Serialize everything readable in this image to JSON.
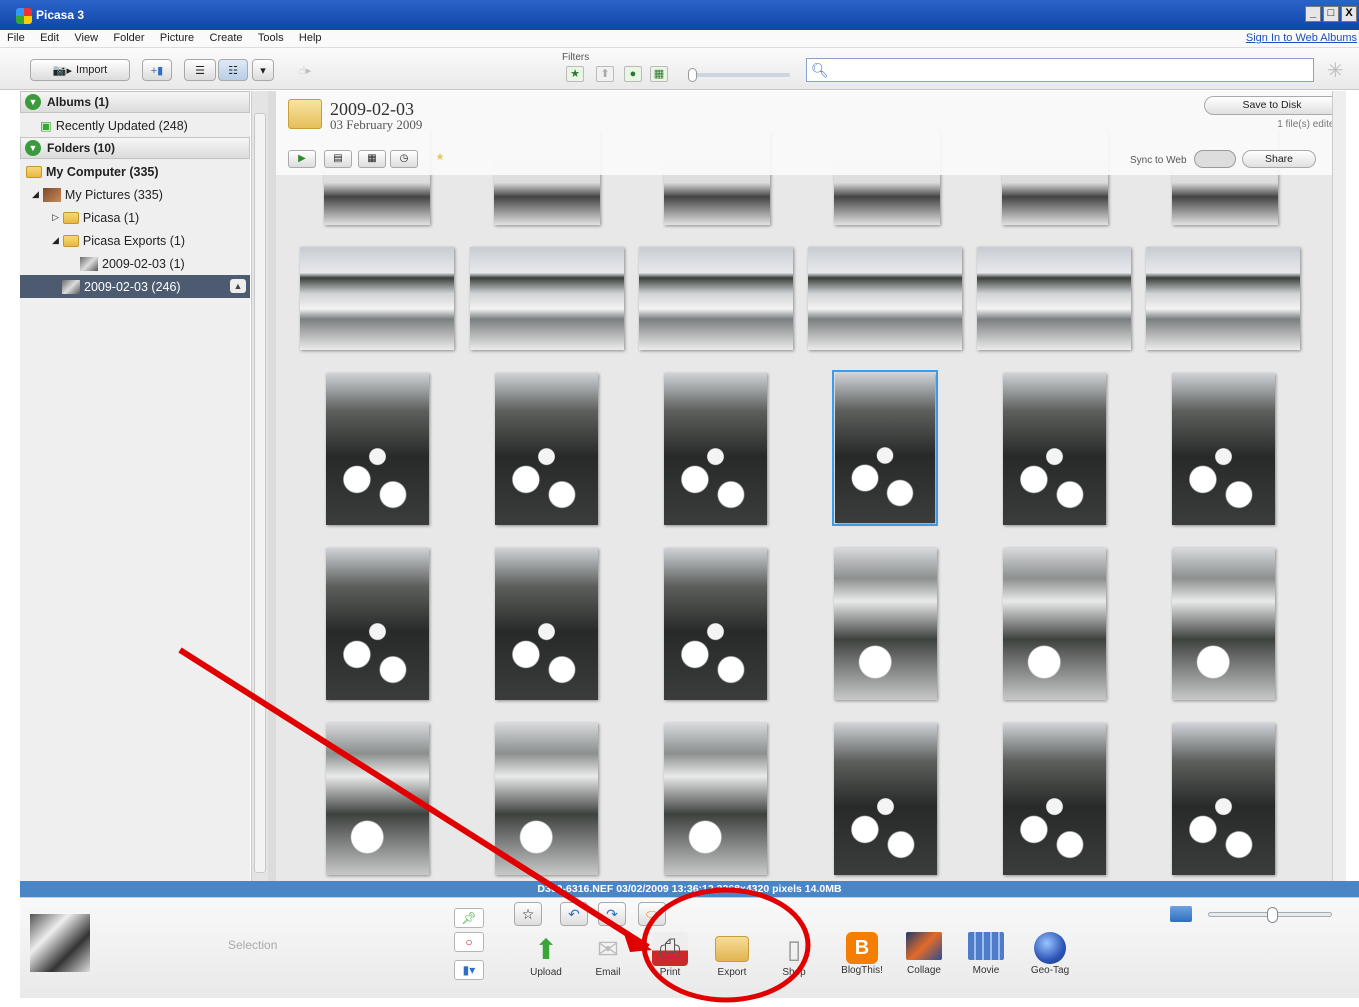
{
  "window": {
    "title": "Picasa 3",
    "controls": [
      "_",
      "□",
      "X"
    ]
  },
  "menu": {
    "items": [
      "File",
      "Edit",
      "View",
      "Folder",
      "Picture",
      "Create",
      "Tools",
      "Help"
    ],
    "sign_in": "Sign In to Web Albums"
  },
  "toolbar": {
    "import_label": "Import",
    "filters_label": "Filters",
    "search_placeholder": ""
  },
  "sidebar": {
    "albums_header": "Albums (1)",
    "recently_updated": "Recently Updated (248)",
    "folders_header": "Folders (10)",
    "my_computer": "My Computer (335)",
    "my_pictures": "My Pictures (335)",
    "picasa": "Picasa (1)",
    "picasa_exports": "Picasa Exports (1)",
    "export_folder": "2009-02-03 (1)",
    "selected_folder": "2009-02-03 (246)"
  },
  "folder_header": {
    "title": "2009-02-03",
    "date": "03 February 2009",
    "save_to_disk": "Save to Disk",
    "files_edited": "1 file(s) edited",
    "sync_to_web": "Sync to Web",
    "share": "Share"
  },
  "status": {
    "text": "D300-6316.NEF   03/02/2009 13:36:12   3268x4320 pixels   14.0MB"
  },
  "tray": {
    "selection_label": "Selection",
    "actions": [
      {
        "label": "Upload",
        "icon": "upload-icon",
        "color": "#3aa63a"
      },
      {
        "label": "Email",
        "icon": "email-icon",
        "color": "#d8d8d8"
      },
      {
        "label": "Print",
        "icon": "print-icon",
        "color": "#cc2a2a"
      },
      {
        "label": "Export",
        "icon": "export-icon",
        "color": "#e8c56a"
      },
      {
        "label": "Shop",
        "icon": "shop-icon",
        "color": "#c9c9c9"
      },
      {
        "label": "BlogThis!",
        "icon": "blogger-icon",
        "color": "#f57d00"
      },
      {
        "label": "Collage",
        "icon": "collage-icon",
        "color": "#3b5f9e"
      },
      {
        "label": "Movie",
        "icon": "movie-icon",
        "color": "#4f7cc9"
      },
      {
        "label": "Geo-Tag",
        "icon": "globe-icon",
        "color": "#2c56b8"
      }
    ]
  },
  "annotation": {
    "color": "#e00000"
  }
}
